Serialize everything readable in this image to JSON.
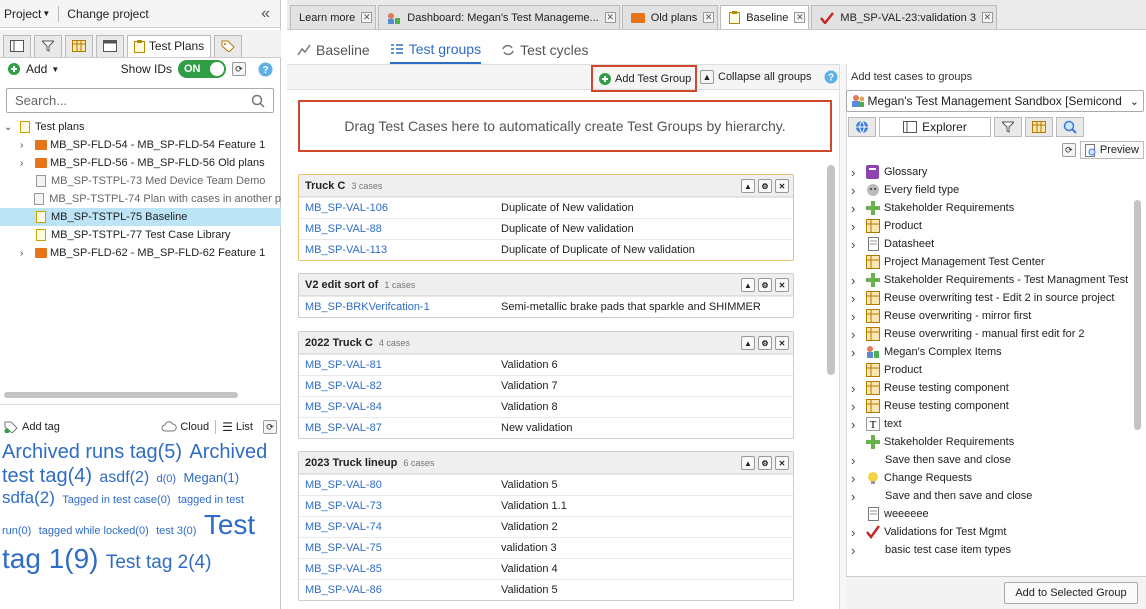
{
  "left": {
    "project_label": "Project",
    "change_project": "Change project",
    "active_tab": "Test Plans",
    "add_label": "Add",
    "show_ids_label": "Show IDs",
    "show_ids_value": "ON",
    "search_placeholder": "Search...",
    "tree": [
      {
        "label": "Test plans",
        "type": "root"
      },
      {
        "label": "MB_SP-FLD-54 - MB_SP-FLD-54 Feature 1",
        "type": "folder"
      },
      {
        "label": "MB_SP-FLD-56 - MB_SP-FLD-56 Old plans",
        "type": "folder"
      },
      {
        "label": "MB_SP-TSTPL-73 Med Device Team Demo",
        "type": "plan-gray"
      },
      {
        "label": "MB_SP-TSTPL-74 Plan with cases in another p",
        "type": "plan-gray"
      },
      {
        "label": "MB_SP-TSTPL-75 Baseline",
        "type": "plan",
        "selected": true
      },
      {
        "label": "MB_SP-TSTPL-77 Test Case Library",
        "type": "plan"
      },
      {
        "label": "MB_SP-FLD-62 - MB_SP-FLD-62 Feature 1",
        "type": "folder"
      }
    ],
    "add_tag": "Add tag",
    "cloud_label": "Cloud",
    "list_label": "List",
    "tags": [
      {
        "t": "Archived runs tag(5)",
        "size": 20
      },
      {
        "t": "Archived test tag(4)",
        "size": 20
      },
      {
        "t": "asdf(2)",
        "size": 16
      },
      {
        "t": "d(0)",
        "size": 11
      },
      {
        "t": "Megan(1)",
        "size": 13
      },
      {
        "t": "sdfa(2)",
        "size": 17
      },
      {
        "t": "Tagged in test case(0)",
        "size": 11
      },
      {
        "t": "tagged in test run(0)",
        "size": 11
      },
      {
        "t": "tagged while locked(0)",
        "size": 11
      },
      {
        "t": "test 3(0)",
        "size": 11
      },
      {
        "t": "Test tag 1(9)",
        "size": 28
      },
      {
        "t": "Test tag 2(4)",
        "size": 19
      }
    ]
  },
  "tabs": [
    {
      "label": "Learn more"
    },
    {
      "label": "Dashboard: Megan's Test Manageme..."
    },
    {
      "label": "Old plans"
    },
    {
      "label": "Baseline",
      "active": true
    },
    {
      "label": "MB_SP-VAL-23:validation 3"
    }
  ],
  "subtabs": [
    "Baseline",
    "Test groups",
    "Test cycles"
  ],
  "toolbar": {
    "add_group": "Add Test Group",
    "collapse": "Collapse all groups"
  },
  "dropzone_text": "Drag Test Cases here to automatically create Test Groups by hierarchy.",
  "groups": [
    {
      "name": "Truck C",
      "count": "3 cases",
      "rows": [
        {
          "id": "MB_SP-VAL-106",
          "name": "Duplicate of New validation"
        },
        {
          "id": "MB_SP-VAL-88",
          "name": "Duplicate of New validation"
        },
        {
          "id": "MB_SP-VAL-113",
          "name": "Duplicate of Duplicate of New validation"
        }
      ]
    },
    {
      "name": "V2 edit sort of",
      "count": "1 cases",
      "rows": [
        {
          "id": "MB_SP-BRKVerifcation-1",
          "name": "Semi-metallic brake pads that sparkle and SHIMMER"
        }
      ]
    },
    {
      "name": "2022 Truck C",
      "count": "4 cases",
      "rows": [
        {
          "id": "MB_SP-VAL-81",
          "name": "Validation 6"
        },
        {
          "id": "MB_SP-VAL-82",
          "name": "Validation 7"
        },
        {
          "id": "MB_SP-VAL-84",
          "name": "Validation 8"
        },
        {
          "id": "MB_SP-VAL-87",
          "name": "New validation"
        }
      ]
    },
    {
      "name": "2023 Truck lineup",
      "count": "6 cases",
      "rows": [
        {
          "id": "MB_SP-VAL-80",
          "name": "Validation 5"
        },
        {
          "id": "MB_SP-VAL-73",
          "name": "Validation 1.1"
        },
        {
          "id": "MB_SP-VAL-74",
          "name": "Validation 2"
        },
        {
          "id": "MB_SP-VAL-75",
          "name": "validation 3"
        },
        {
          "id": "MB_SP-VAL-85",
          "name": "Validation 4"
        },
        {
          "id": "MB_SP-VAL-86",
          "name": "Validation 5"
        }
      ]
    }
  ],
  "rightpanel": {
    "title": "Add test cases to groups",
    "project": "Megan's Test Management Sandbox [Semicond",
    "explorer": "Explorer",
    "preview": "Preview",
    "items": [
      {
        "label": "Glossary",
        "icon": "purple"
      },
      {
        "label": "Every field type",
        "icon": "face"
      },
      {
        "label": "Stakeholder Requirements",
        "icon": "green"
      },
      {
        "label": "Product",
        "icon": "grid"
      },
      {
        "label": "Datasheet",
        "icon": "doc"
      },
      {
        "label": "Project Management Test Center",
        "icon": "grid",
        "nocaret": true
      },
      {
        "label": "Stakeholder Requirements - Test Managment Test",
        "icon": "green"
      },
      {
        "label": "Reuse overwriting test - Edit 2 in source project",
        "icon": "grid"
      },
      {
        "label": "Reuse overwriting - mirror first",
        "icon": "grid"
      },
      {
        "label": "Reuse overwriting - manual first edit for 2",
        "icon": "grid"
      },
      {
        "label": "Megan's Complex Items",
        "icon": "people"
      },
      {
        "label": "Product",
        "icon": "grid",
        "nocaret": true
      },
      {
        "label": "Reuse testing component",
        "icon": "grid"
      },
      {
        "label": "Reuse testing component",
        "icon": "grid"
      },
      {
        "label": "text",
        "icon": "text"
      },
      {
        "label": "Stakeholder Requirements",
        "icon": "green",
        "nocaret": true
      },
      {
        "label": "Save then save and close",
        "icon": "blank"
      },
      {
        "label": "Change Requests",
        "icon": "bulb"
      },
      {
        "label": "Save and then save and close",
        "icon": "blank"
      },
      {
        "label": "weeeeee",
        "icon": "doc",
        "nocaret": true
      },
      {
        "label": "Validations for Test Mgmt",
        "icon": "check"
      },
      {
        "label": "basic test case item types",
        "icon": "blank"
      }
    ],
    "add_button": "Add to Selected Group"
  },
  "colors": {
    "accent": "#2f6cc6",
    "highlight": "#d1472b",
    "toggle": "#2f9e44"
  }
}
